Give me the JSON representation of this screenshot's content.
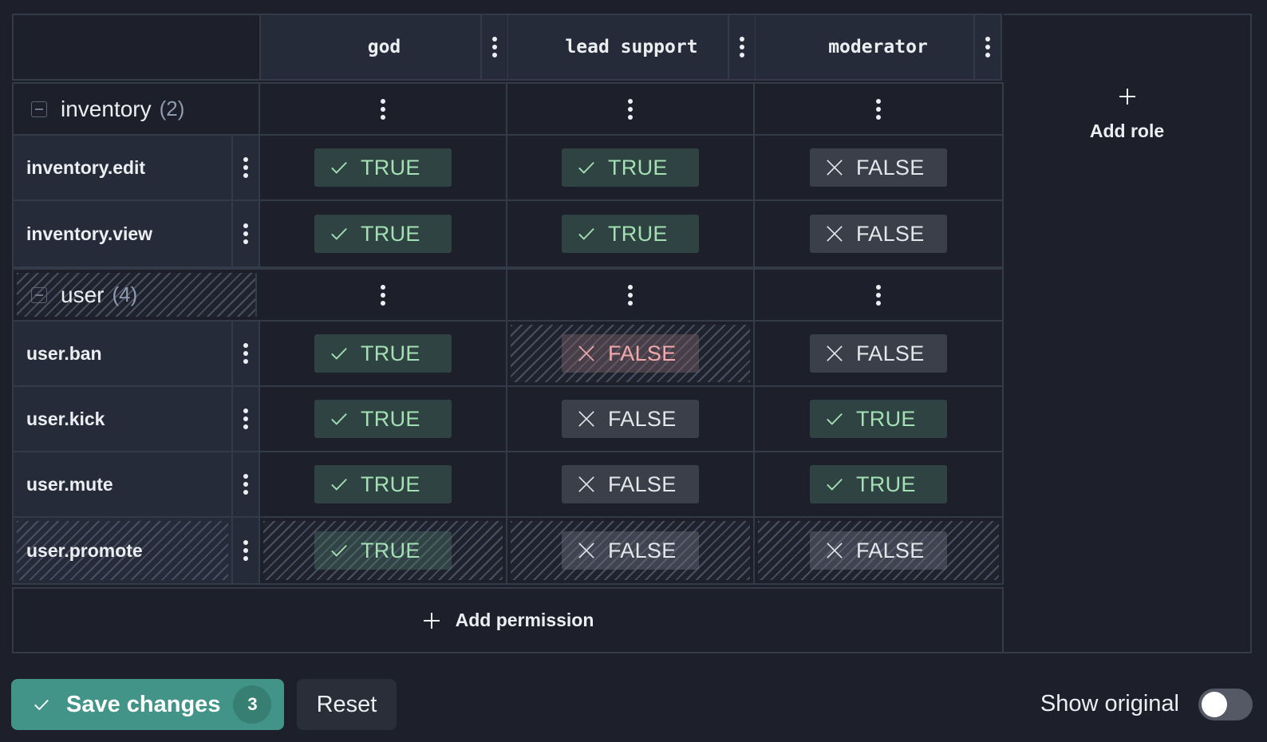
{
  "roles": [
    {
      "name": "god"
    },
    {
      "name": "lead support"
    },
    {
      "name": "moderator"
    }
  ],
  "add_role_label": "Add role",
  "add_permission_label": "Add permission",
  "groups": [
    {
      "name": "inventory",
      "count": "(2)",
      "changed": false,
      "permissions": [
        {
          "name": "inventory.edit",
          "changed": false,
          "values": [
            {
              "value": "TRUE",
              "changed": false
            },
            {
              "value": "TRUE",
              "changed": false
            },
            {
              "value": "FALSE",
              "changed": false
            }
          ]
        },
        {
          "name": "inventory.view",
          "changed": false,
          "values": [
            {
              "value": "TRUE",
              "changed": false
            },
            {
              "value": "TRUE",
              "changed": false
            },
            {
              "value": "FALSE",
              "changed": false
            }
          ]
        }
      ]
    },
    {
      "name": "user",
      "count": "(4)",
      "changed": true,
      "permissions": [
        {
          "name": "user.ban",
          "changed": false,
          "values": [
            {
              "value": "TRUE",
              "changed": false
            },
            {
              "value": "FALSE",
              "changed": true
            },
            {
              "value": "FALSE",
              "changed": false
            }
          ]
        },
        {
          "name": "user.kick",
          "changed": false,
          "values": [
            {
              "value": "TRUE",
              "changed": false
            },
            {
              "value": "FALSE",
              "changed": false
            },
            {
              "value": "TRUE",
              "changed": false
            }
          ]
        },
        {
          "name": "user.mute",
          "changed": false,
          "values": [
            {
              "value": "TRUE",
              "changed": false
            },
            {
              "value": "FALSE",
              "changed": false
            },
            {
              "value": "TRUE",
              "changed": false
            }
          ]
        },
        {
          "name": "user.promote",
          "changed": true,
          "new": true,
          "values": [
            {
              "value": "TRUE",
              "changed": true
            },
            {
              "value": "FALSE",
              "changed": true
            },
            {
              "value": "FALSE",
              "changed": true
            }
          ]
        }
      ]
    }
  ],
  "footer": {
    "save_label": "Save changes",
    "save_count": "3",
    "reset_label": "Reset",
    "show_original_label": "Show original",
    "show_original_on": false
  },
  "colors": {
    "accent": "#439488",
    "true_text": "#a3e1b4",
    "changed_false_text": "#f2a9ad",
    "background": "#1d202a"
  },
  "icons": {
    "collapse": "minus-square-icon",
    "menu": "kebab-icon",
    "true": "check-icon",
    "false": "x-icon",
    "add": "plus-icon"
  }
}
